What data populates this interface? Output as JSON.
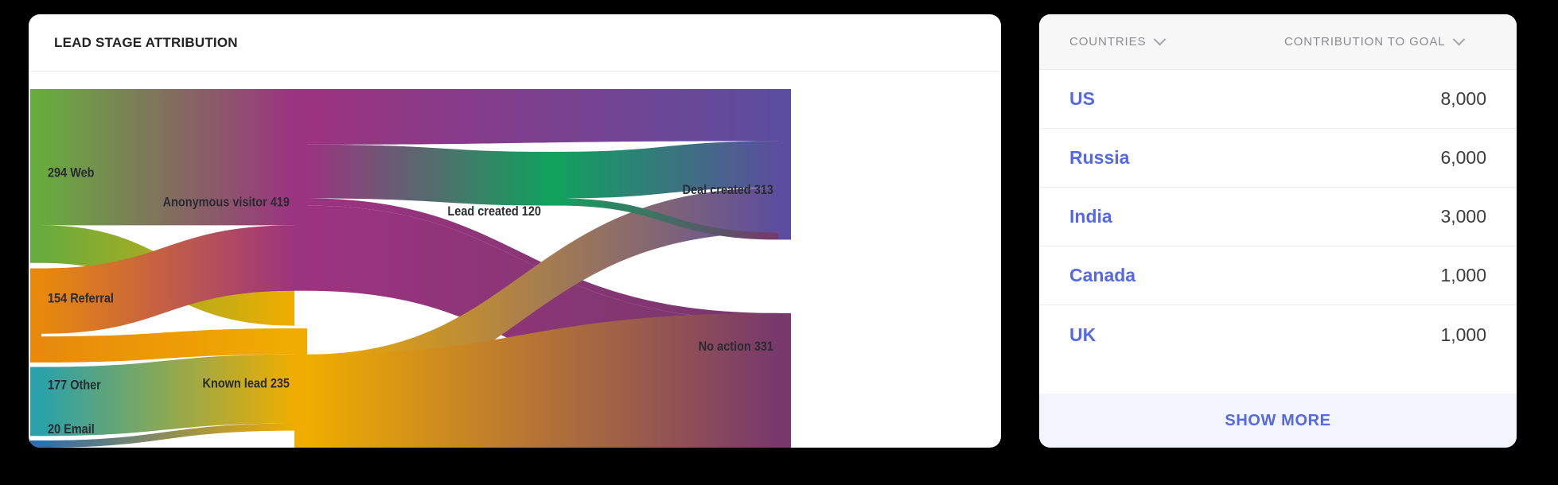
{
  "sankey_card": {
    "title": "LEAD STAGE ATTRIBUTION"
  },
  "chart_data": {
    "type": "sankey",
    "title": "LEAD STAGE ATTRIBUTION",
    "nodes": [
      {
        "id": "web",
        "label": "294 Web",
        "value": 294,
        "column": 0,
        "color": "#68ab3e"
      },
      {
        "id": "referral",
        "label": "154 Referral",
        "value": 154,
        "column": 0,
        "color": "#e8890c"
      },
      {
        "id": "other",
        "label": "177 Other",
        "value": 177,
        "column": 0,
        "color": "#2aa2a8"
      },
      {
        "id": "email",
        "label": "20 Email",
        "value": 20,
        "column": 0,
        "color": "#2d6eae"
      },
      {
        "id": "anon",
        "label": "Anonymous visitor 419",
        "value": 419,
        "column": 1,
        "color": "#9c3380"
      },
      {
        "id": "known",
        "label": "Known lead 235",
        "value": 235,
        "column": 1,
        "color": "#f0ad00"
      },
      {
        "id": "leadcr",
        "label": "Lead created 120",
        "value": 120,
        "column": 2,
        "color": "#12a05e"
      },
      {
        "id": "deal",
        "label": "Deal created 313",
        "value": 313,
        "column": 3,
        "color": "#5c4d9e"
      },
      {
        "id": "noaction",
        "label": "No action 331",
        "value": 331,
        "column": 3,
        "color": "#77386c"
      }
    ],
    "links": [
      {
        "source": "web",
        "target": "anon",
        "value": 230
      },
      {
        "source": "web",
        "target": "known",
        "value": 64
      },
      {
        "source": "referral",
        "target": "anon",
        "value": 110
      },
      {
        "source": "referral",
        "target": "known",
        "value": 44
      },
      {
        "source": "other",
        "target": "known",
        "value": 117
      },
      {
        "source": "other",
        "target": "anon",
        "value": 60
      },
      {
        "source": "email",
        "target": "known",
        "value": 10
      },
      {
        "source": "email",
        "target": "anon",
        "value": 10
      },
      {
        "source": "anon",
        "target": "leadcr",
        "value": 120
      },
      {
        "source": "anon",
        "target": "deal",
        "value": 110
      },
      {
        "source": "anon",
        "target": "noaction",
        "value": 189
      },
      {
        "source": "known",
        "target": "deal",
        "value": 93
      },
      {
        "source": "known",
        "target": "noaction",
        "value": 142
      },
      {
        "source": "leadcr",
        "target": "deal",
        "value": 110
      },
      {
        "source": "leadcr",
        "target": "noaction",
        "value": 10
      }
    ],
    "labels": {
      "web": "294 Web",
      "referral": "154 Referral",
      "other": "177 Other",
      "email": "20 Email",
      "anon": "Anonymous visitor 419",
      "known": "Known lead 235",
      "leadcr": "Lead created 120",
      "deal": "Deal created 313",
      "noaction": "No action 331"
    }
  },
  "countries_card": {
    "columns": [
      {
        "key": "country",
        "label": "COUNTRIES",
        "icon": "chevron-down-icon"
      },
      {
        "key": "value",
        "label": "CONTRIBUTION TO GOAL",
        "icon": "chevron-down-icon"
      }
    ],
    "rows": [
      {
        "country": "US",
        "value": "8,000"
      },
      {
        "country": "Russia",
        "value": "6,000"
      },
      {
        "country": "India",
        "value": "3,000"
      },
      {
        "country": "Canada",
        "value": "1,000"
      },
      {
        "country": "UK",
        "value": "1,000"
      }
    ],
    "show_more_label": "SHOW MORE",
    "accent_color": "#5568e8"
  }
}
